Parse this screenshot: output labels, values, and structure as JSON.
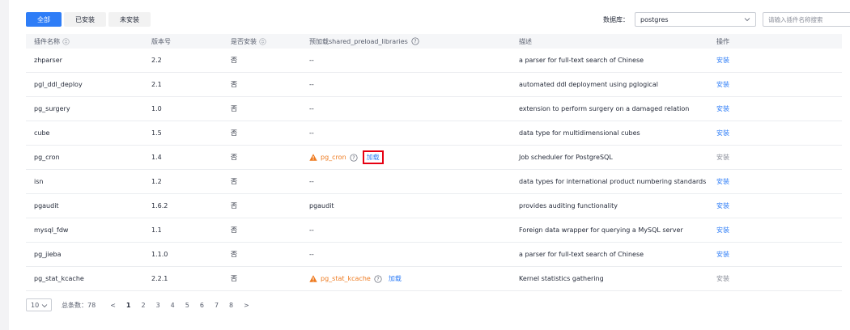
{
  "tabs": [
    {
      "label": "全部",
      "active": true
    },
    {
      "label": "已安装",
      "active": false
    },
    {
      "label": "未安装",
      "active": false
    }
  ],
  "filter": {
    "db_label": "数据库：",
    "db_value": "postgres",
    "search_placeholder": "请输入插件名称搜索"
  },
  "columns": {
    "name": "插件名称",
    "version": "版本号",
    "installed": "是否安装",
    "preload": "预加载shared_preload_libraries",
    "desc": "描述",
    "action": "操作"
  },
  "rows": [
    {
      "name": "zhparser",
      "version": "2.2",
      "installed": "否",
      "preload": "--",
      "desc": "a parser for full-text search of Chinese",
      "action": "安装"
    },
    {
      "name": "pgl_ddl_deploy",
      "version": "2.1",
      "installed": "否",
      "preload": "--",
      "desc": "automated ddl deployment using pglogical",
      "action": "安装"
    },
    {
      "name": "pg_surgery",
      "version": "1.0",
      "installed": "否",
      "preload": "--",
      "desc": "extension to perform surgery on a damaged relation",
      "action": "安装"
    },
    {
      "name": "cube",
      "version": "1.5",
      "installed": "否",
      "preload": "--",
      "desc": "data type for multidimensional cubes",
      "action": "安装"
    },
    {
      "name": "pg_cron",
      "version": "1.4",
      "installed": "否",
      "preload_warn": "pg_cron",
      "preload_action": "加载",
      "desc": "Job scheduler for PostgreSQL",
      "action": "安装"
    },
    {
      "name": "isn",
      "version": "1.2",
      "installed": "否",
      "preload": "--",
      "desc": "data types for international product numbering standards",
      "action": "安装"
    },
    {
      "name": "pgaudit",
      "version": "1.6.2",
      "installed": "否",
      "preload": "pgaudit",
      "desc": "provides auditing functionality",
      "action": "安装"
    },
    {
      "name": "mysql_fdw",
      "version": "1.1",
      "installed": "否",
      "preload": "--",
      "desc": "Foreign data wrapper for querying a MySQL server",
      "action": "安装"
    },
    {
      "name": "pg_jieba",
      "version": "1.1.0",
      "installed": "否",
      "preload": "--",
      "desc": "a parser for full-text search of Chinese",
      "action": "安装"
    },
    {
      "name": "pg_stat_kcache",
      "version": "2.2.1",
      "installed": "否",
      "preload_warn": "pg_stat_kcache",
      "preload_action": "加载",
      "desc": "Kernel statistics gathering",
      "action": "安装"
    }
  ],
  "pagination": {
    "page_size": "10",
    "total_label": "总条数：78",
    "prev": "<",
    "pages": [
      "1",
      "2",
      "3",
      "4",
      "5",
      "6",
      "7",
      "8"
    ],
    "current": "1",
    "next": ">"
  },
  "colors": {
    "accent": "#2e7df7",
    "warning": "#ee7a1f",
    "highlight_box": "#e60012"
  }
}
